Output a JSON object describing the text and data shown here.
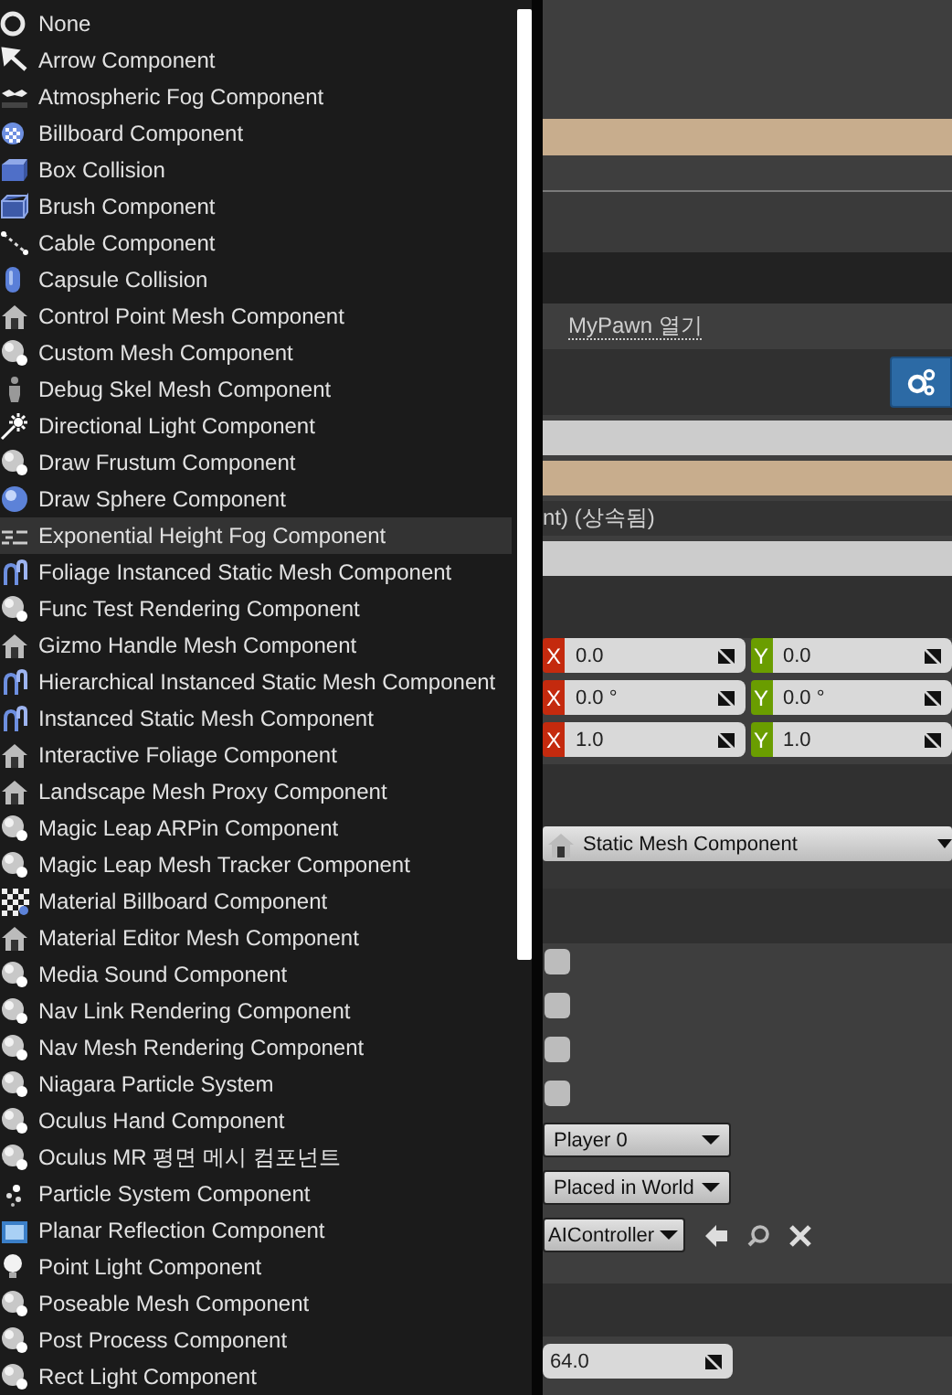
{
  "component_menu": {
    "items": [
      {
        "label": "None",
        "kind": "ring",
        "selected": false
      },
      {
        "label": "Arrow Component",
        "kind": "arrow",
        "selected": false
      },
      {
        "label": "Atmospheric Fog Component",
        "kind": "cloud",
        "selected": false
      },
      {
        "label": "Billboard Component",
        "kind": "dotted-ball",
        "selected": false
      },
      {
        "label": "Box Collision",
        "kind": "cube",
        "selected": false
      },
      {
        "label": "Brush Component",
        "kind": "wire-cube",
        "selected": false
      },
      {
        "label": "Cable Component",
        "kind": "dotted-line",
        "selected": false
      },
      {
        "label": "Capsule Collision",
        "kind": "capsule",
        "selected": false
      },
      {
        "label": "Control Point Mesh Component",
        "kind": "house",
        "selected": false
      },
      {
        "label": "Custom Mesh Component",
        "kind": "sphere",
        "selected": false
      },
      {
        "label": "Debug Skel Mesh Component",
        "kind": "figure",
        "selected": false
      },
      {
        "label": "Directional Light Component",
        "kind": "sun",
        "selected": false
      },
      {
        "label": "Draw Frustum Component",
        "kind": "sphere",
        "selected": false
      },
      {
        "label": "Draw Sphere Component",
        "kind": "blue-sphere",
        "selected": false
      },
      {
        "label": "Exponential Height Fog Component",
        "kind": "lines",
        "selected": true
      },
      {
        "label": "Foliage Instanced Static Mesh Component",
        "kind": "arch",
        "selected": false
      },
      {
        "label": "Func Test Rendering Component",
        "kind": "sphere",
        "selected": false
      },
      {
        "label": "Gizmo Handle Mesh Component",
        "kind": "house",
        "selected": false
      },
      {
        "label": "Hierarchical Instanced Static Mesh Component",
        "kind": "arch",
        "selected": false
      },
      {
        "label": "Instanced Static Mesh Component",
        "kind": "arch",
        "selected": false
      },
      {
        "label": "Interactive Foliage Component",
        "kind": "house",
        "selected": false
      },
      {
        "label": "Landscape Mesh Proxy Component",
        "kind": "house",
        "selected": false
      },
      {
        "label": "Magic Leap ARPin Component",
        "kind": "sphere",
        "selected": false
      },
      {
        "label": "Magic Leap Mesh Tracker Component",
        "kind": "sphere",
        "selected": false
      },
      {
        "label": "Material Billboard Component",
        "kind": "checker",
        "selected": false
      },
      {
        "label": "Material Editor Mesh Component",
        "kind": "house",
        "selected": false
      },
      {
        "label": "Media Sound Component",
        "kind": "sphere",
        "selected": false
      },
      {
        "label": "Nav Link Rendering Component",
        "kind": "sphere",
        "selected": false
      },
      {
        "label": "Nav Mesh Rendering Component",
        "kind": "sphere",
        "selected": false
      },
      {
        "label": "Niagara Particle System",
        "kind": "sphere",
        "selected": false
      },
      {
        "label": "Oculus Hand Component",
        "kind": "sphere",
        "selected": false
      },
      {
        "label": "Oculus MR 평면 메시 컴포넌트",
        "kind": "sphere",
        "selected": false
      },
      {
        "label": "Particle System Component",
        "kind": "sparkle",
        "selected": false
      },
      {
        "label": "Planar Reflection Component",
        "kind": "screen",
        "selected": false
      },
      {
        "label": "Point Light Component",
        "kind": "bulb",
        "selected": false
      },
      {
        "label": "Poseable Mesh Component",
        "kind": "sphere",
        "selected": false
      },
      {
        "label": "Post Process Component",
        "kind": "sphere",
        "selected": false
      },
      {
        "label": "Rect Light Component",
        "kind": "sphere",
        "selected": false
      }
    ]
  },
  "details": {
    "open_link": "MyPawn 열기",
    "inherited_label": "nt) (상속됨)",
    "vector_rows": [
      {
        "fields": [
          {
            "axis": "X",
            "value": "0.0"
          },
          {
            "axis": "Y",
            "value": "0.0"
          }
        ]
      },
      {
        "fields": [
          {
            "axis": "X",
            "value": "0.0 °"
          },
          {
            "axis": "Y",
            "value": "0.0 °"
          }
        ]
      },
      {
        "fields": [
          {
            "axis": "X",
            "value": "1.0"
          },
          {
            "axis": "Y",
            "value": "1.0"
          }
        ]
      }
    ],
    "component_dropdown": "Static Mesh Component",
    "checkboxes": [
      {
        "checked": false
      },
      {
        "checked": false
      },
      {
        "checked": false
      },
      {
        "checked": false
      }
    ],
    "dropdowns": [
      "Player 0",
      "Placed in World"
    ],
    "controller_dropdown": "AIController",
    "number_field": "64.0"
  }
}
